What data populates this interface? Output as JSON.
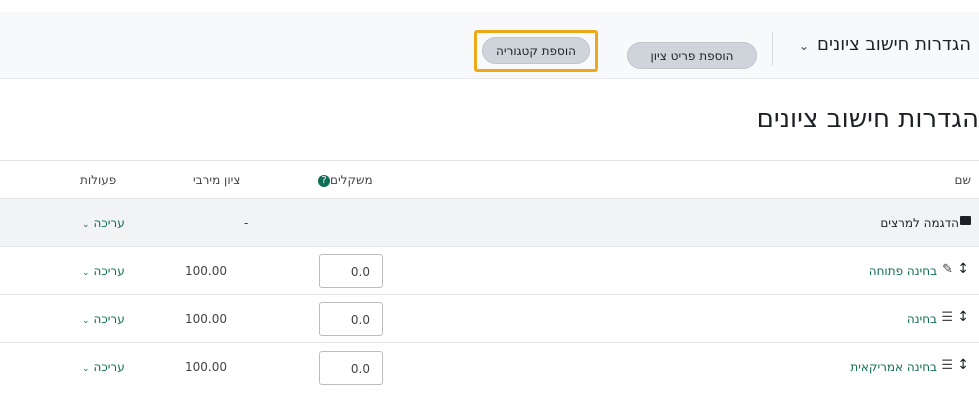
{
  "header": {
    "nav_select": "הגדרות חישוב ציונים",
    "add_item_button": "הוספת פריט ציון",
    "add_category_button": "הוספת קטגוריה"
  },
  "page_title": "הגדרות חישוב ציונים",
  "table": {
    "columns": {
      "name": "שם",
      "weights": "משקלים",
      "max_grade": "ציון מירבי",
      "actions": "פעולות"
    },
    "category": {
      "name": "הדגמה למרצים",
      "max_grade": "-",
      "action": "עריכה"
    },
    "items": [
      {
        "name": "בחינה פתוחה",
        "weight": "0.0",
        "max_grade": "100.00",
        "action": "עריכה"
      },
      {
        "name": "בחינה",
        "weight": "0.0",
        "max_grade": "100.00",
        "action": "עריכה"
      },
      {
        "name": "בחינה אמריקאית",
        "weight": "0.0",
        "max_grade": "100.00",
        "action": "עריכה"
      }
    ]
  },
  "colors": {
    "highlight": "#f0a81b",
    "link": "#0f6e55",
    "info_icon": "#0f6e55"
  }
}
